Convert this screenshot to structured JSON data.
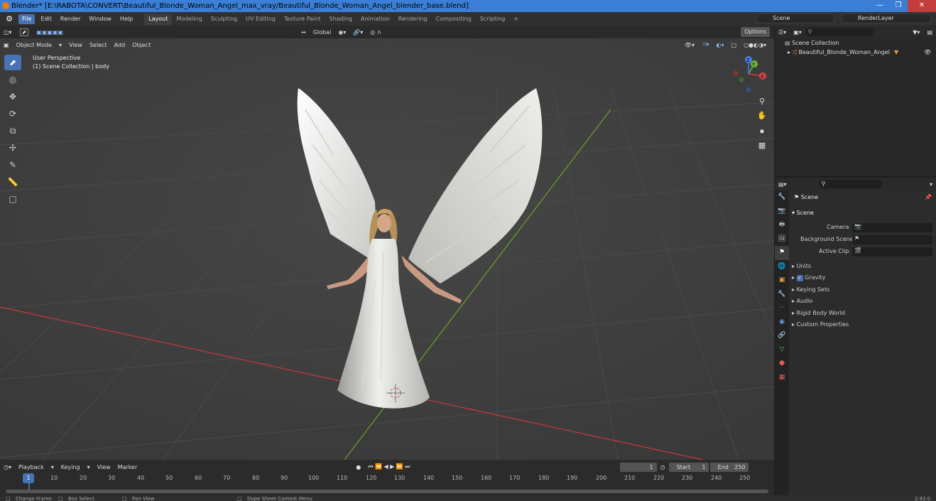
{
  "window": {
    "title": "Blender* [E:\\RABOTA\\CONVERT\\Beautiful_Blonde_Woman_Angel_max_vray/Beautiful_Blonde_Woman_Angel_blender_base.blend]"
  },
  "menu": {
    "items": [
      "File",
      "Edit",
      "Render",
      "Window",
      "Help"
    ]
  },
  "workspaces": [
    "Layout",
    "Modeling",
    "Sculpting",
    "UV Editing",
    "Texture Paint",
    "Shading",
    "Animation",
    "Rendering",
    "Compositing",
    "Scripting"
  ],
  "scene": {
    "name": "Scene",
    "view_layer": "RenderLayer"
  },
  "viewport_header": {
    "mode": "Object Mode",
    "menus": [
      "View",
      "Select",
      "Add",
      "Object"
    ],
    "orientation": "Global",
    "options": "Options"
  },
  "viewport": {
    "perspective": "User Perspective",
    "collection_info": "(1) Scene Collection | body"
  },
  "gizmo": {
    "x": "X",
    "y": "Y",
    "z": "Z"
  },
  "outliner": {
    "root": "Scene Collection",
    "object": "Beautiful_Blonde_Woman_Angel"
  },
  "properties": {
    "title": "Scene",
    "section": "Scene",
    "fields": [
      "Camera",
      "Background Scene",
      "Active Clip"
    ],
    "panels": [
      "Units",
      "Gravity",
      "Keying Sets",
      "Audio",
      "Rigid Body World",
      "Custom Properties"
    ]
  },
  "timeline": {
    "menus": [
      "Playback",
      "Keying",
      "View",
      "Marker"
    ],
    "current_frame": "1",
    "start_label": "Start",
    "start": "1",
    "end_label": "End",
    "end": "250",
    "ticks": [
      "1",
      "10",
      "20",
      "30",
      "40",
      "50",
      "60",
      "70",
      "80",
      "90",
      "100",
      "110",
      "120",
      "130",
      "140",
      "150",
      "160",
      "170",
      "180",
      "190",
      "200",
      "210",
      "220",
      "230",
      "240",
      "250"
    ]
  },
  "status": {
    "left": "Change Frame",
    "box": "Box Select",
    "pan": "Pan View",
    "ctx": "Dope Sheet Context Menu",
    "version": "2.92.0"
  },
  "colors": {
    "accent": "#4772b3",
    "title_bar": "#3a7fd5",
    "grid_red": "#c0393b",
    "grid_green": "#6a9a2c"
  }
}
